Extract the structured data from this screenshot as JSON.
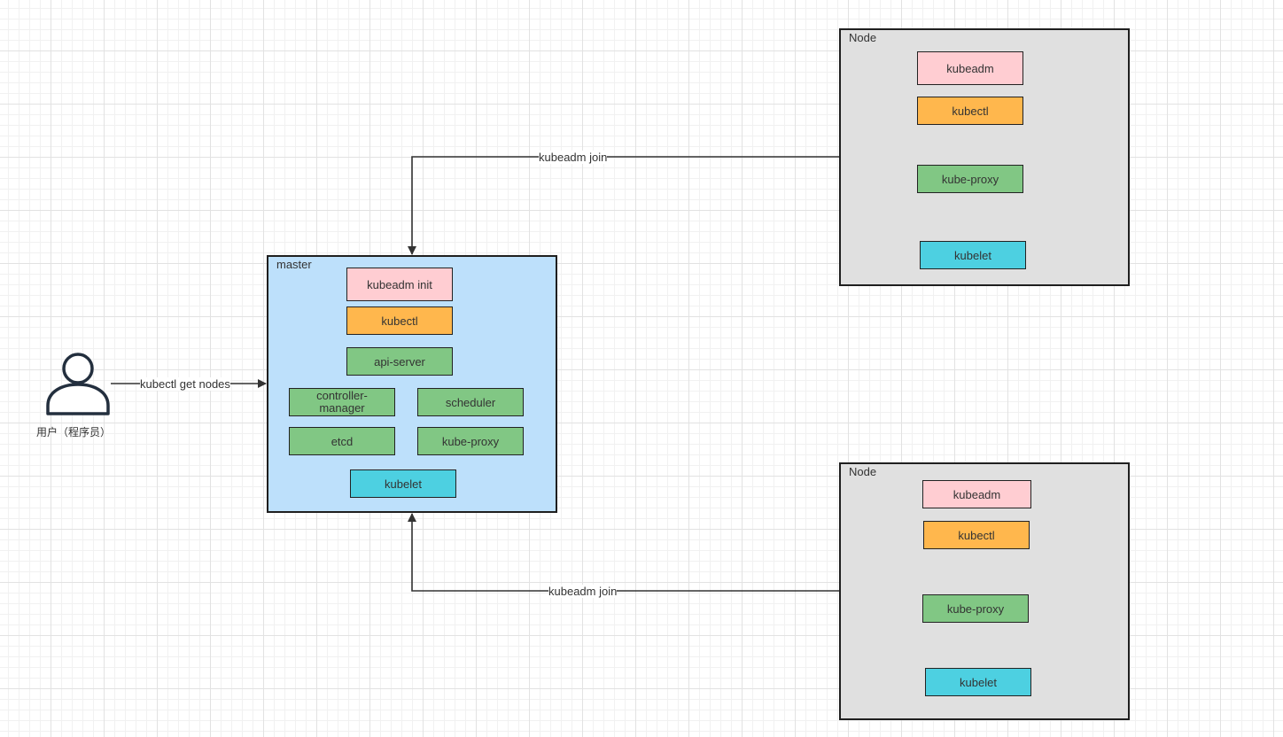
{
  "colors": {
    "master_fill": "#bde0fb",
    "node_fill": "#e0e0e0",
    "kubeadm_fill": "#ffcdd2",
    "kubectl_fill": "#ffb74d",
    "control_fill": "#81c784",
    "kubelet_fill": "#4dd0e1",
    "line": "#333333"
  },
  "user": {
    "icon": "user-icon",
    "caption": "用户（程序员）",
    "edge_label": "kubectl get nodes"
  },
  "master": {
    "label": "master",
    "components": {
      "kubeadm_init": "kubeadm init",
      "kubectl": "kubectl",
      "api_server": "api-server",
      "controller_manager": "controller-\nmanager",
      "scheduler": "scheduler",
      "etcd": "etcd",
      "kube_proxy": "kube-proxy",
      "kubelet": "kubelet"
    }
  },
  "nodes": [
    {
      "label": "Node",
      "edge_label": "kubeadm join",
      "components": {
        "kubeadm": "kubeadm",
        "kubectl": "kubectl",
        "kube_proxy": "kube-proxy",
        "kubelet": "kubelet"
      }
    },
    {
      "label": "Node",
      "edge_label": "kubeadm join",
      "components": {
        "kubeadm": "kubeadm",
        "kubectl": "kubectl",
        "kube_proxy": "kube-proxy",
        "kubelet": "kubelet"
      }
    }
  ]
}
